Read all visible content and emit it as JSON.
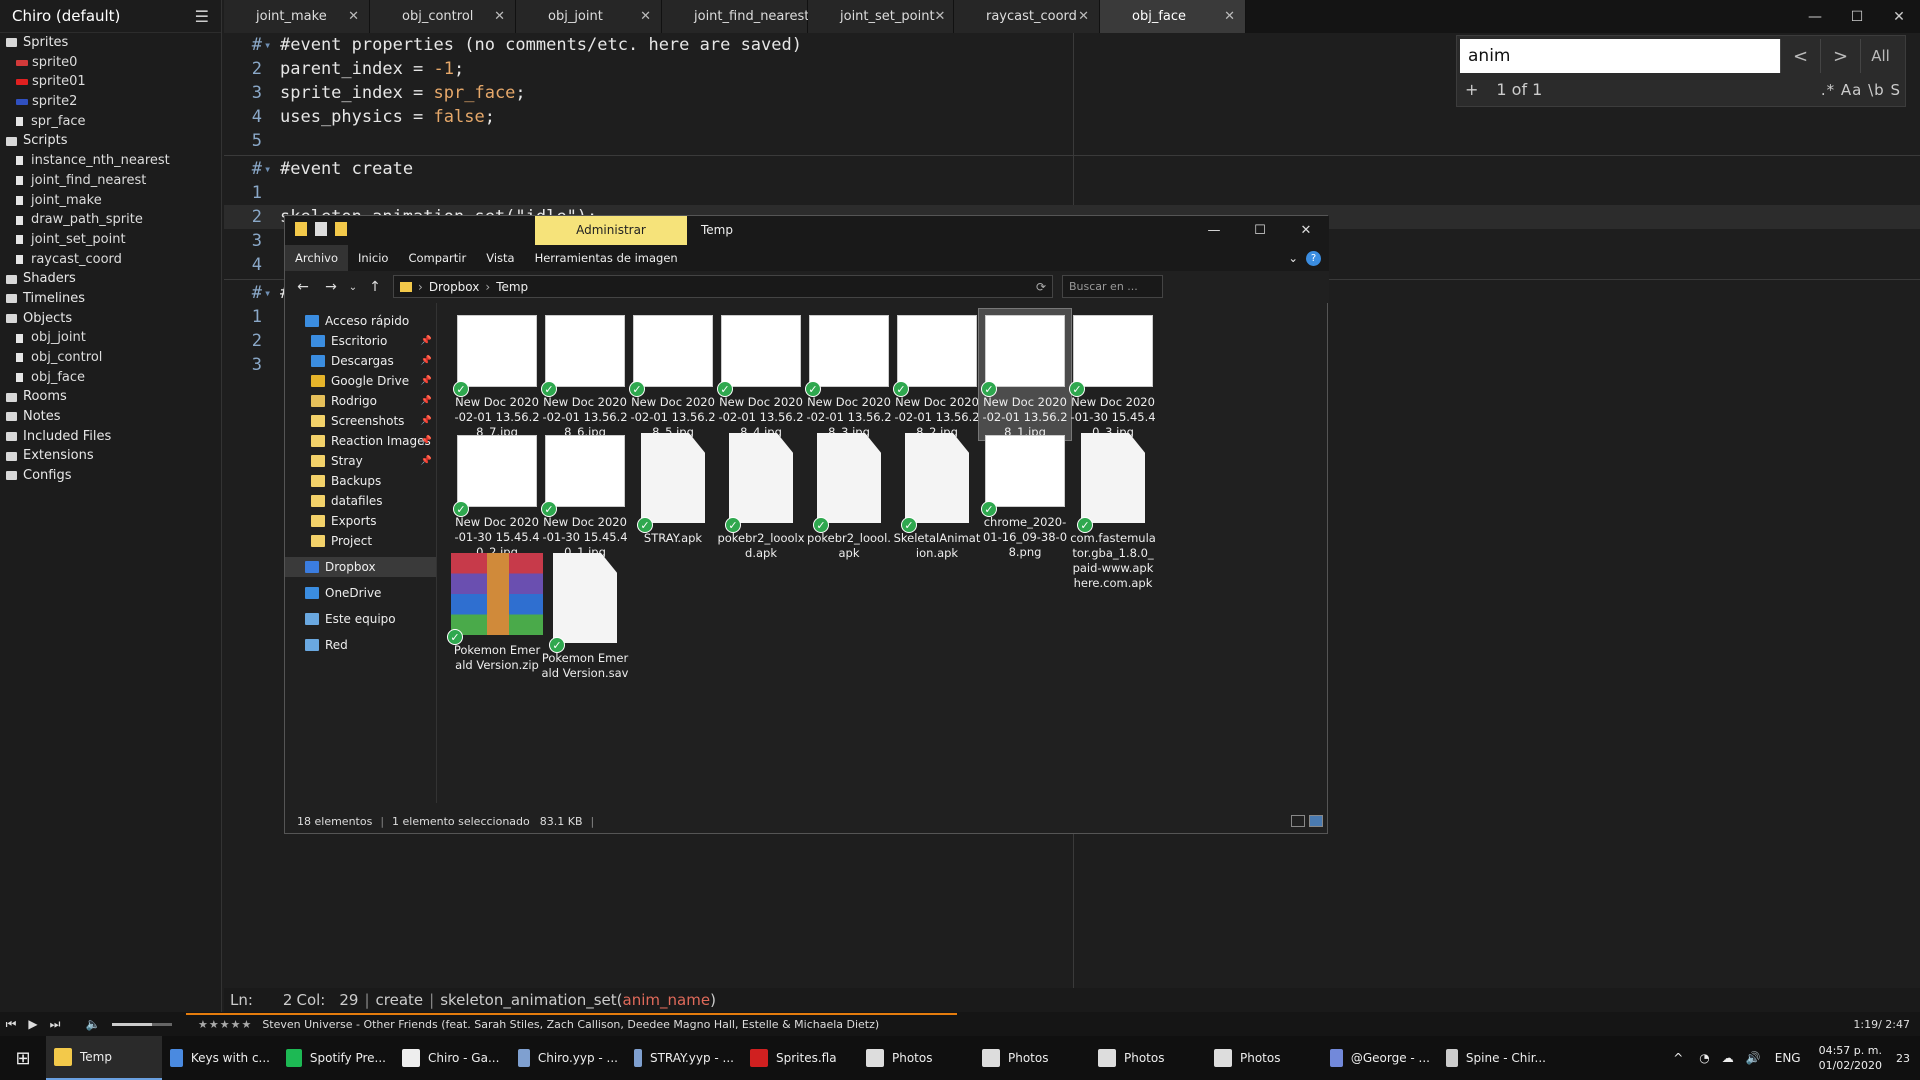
{
  "ide": {
    "project_title": "Chiro (default)",
    "tree": [
      {
        "type": "folder",
        "label": "Sprites"
      },
      {
        "type": "sprite",
        "label": "sprite0",
        "color": "#d23a3a"
      },
      {
        "type": "sprite",
        "label": "sprite01",
        "color": "#e02020"
      },
      {
        "type": "sprite",
        "label": "sprite2",
        "color": "#3050c0"
      },
      {
        "type": "item",
        "label": "spr_face"
      },
      {
        "type": "folder",
        "label": "Scripts"
      },
      {
        "type": "item",
        "label": "instance_nth_nearest"
      },
      {
        "type": "item",
        "label": "joint_find_nearest"
      },
      {
        "type": "item",
        "label": "joint_make"
      },
      {
        "type": "item",
        "label": "draw_path_sprite"
      },
      {
        "type": "item",
        "label": "joint_set_point"
      },
      {
        "type": "item",
        "label": "raycast_coord"
      },
      {
        "type": "folder",
        "label": "Shaders"
      },
      {
        "type": "folder",
        "label": "Timelines"
      },
      {
        "type": "folder",
        "label": "Objects"
      },
      {
        "type": "item",
        "label": "obj_joint"
      },
      {
        "type": "item",
        "label": "obj_control"
      },
      {
        "type": "item",
        "label": "obj_face"
      },
      {
        "type": "folder",
        "label": "Rooms"
      },
      {
        "type": "folder",
        "label": "Notes"
      },
      {
        "type": "folder",
        "label": "Included Files"
      },
      {
        "type": "folder",
        "label": "Extensions"
      },
      {
        "type": "folder",
        "label": "Configs"
      }
    ],
    "tabs": [
      "joint_make",
      "obj_control",
      "obj_joint",
      "joint_find_nearest",
      "joint_set_point",
      "raycast_coord",
      "obj_face"
    ],
    "active_tab": "obj_face",
    "code": {
      "l1_num": "#",
      "l1_comment": "#event properties (no comments/etc. here are saved)",
      "l2_num": "2",
      "l2_a": "parent_index = ",
      "l2_b": "-1",
      ";": ";",
      "l3_num": "3",
      "l3_a": "sprite_index = ",
      "l3_b": "spr_face",
      "l4_num": "4",
      "l4_a": "uses_physics = ",
      "l4_b": "false",
      "l5_num": "5",
      "l6_num": "#",
      "l6_comment": "#event create",
      "l7_num": "1",
      "l8_num": "2",
      "l8_text": "skeleton_animation_set(\"idle\");",
      "l9_num": "3",
      "l10_num": "4",
      "l11_num": "#",
      "l11_text": "#",
      "l12_num": "1",
      "l13_num": "2",
      "l14_num": "3"
    },
    "find": {
      "query": "anim",
      "prev": "<",
      "next": ">",
      "all": "All",
      "plus": "+",
      "count": "1 of 1",
      "options": ".* Aa \\b S"
    },
    "status": {
      "ln": "Ln:",
      "ln_val": "2",
      "col": "Col:",
      "col_val": "29",
      "event": "create",
      "fn": "skeleton_animation_set(",
      "arg": "anim_name",
      ")": ")"
    }
  },
  "explorer": {
    "title": "Temp",
    "context_tab": "Administrar",
    "ribbon": [
      "Archivo",
      "Inicio",
      "Compartir",
      "Vista",
      "Herramientas de imagen"
    ],
    "path": [
      "Dropbox",
      "Temp"
    ],
    "search_placeholder": "Buscar en ...",
    "nav": [
      {
        "label": "Acceso rápido",
        "pin": false,
        "color": "#3b8de0"
      },
      {
        "label": "Escritorio",
        "pin": true,
        "color": "#3b8de0"
      },
      {
        "label": "Descargas",
        "pin": true,
        "color": "#3b8de0"
      },
      {
        "label": "Google Drive",
        "pin": true,
        "color": "#e6b42a"
      },
      {
        "label": "Rodrigo",
        "pin": true,
        "color": "#e6c05a"
      },
      {
        "label": "Screenshots",
        "pin": true,
        "color": "#f3d26a"
      },
      {
        "label": "Reaction Images",
        "pin": true,
        "color": "#f3d26a"
      },
      {
        "label": "Stray",
        "pin": true,
        "color": "#f3d26a"
      },
      {
        "label": "Backups",
        "pin": false,
        "color": "#f3d26a"
      },
      {
        "label": "datafiles",
        "pin": false,
        "color": "#f3d26a"
      },
      {
        "label": "Exports",
        "pin": false,
        "color": "#f3d26a"
      },
      {
        "label": "Project",
        "pin": false,
        "color": "#f3d26a"
      },
      {
        "label": "Dropbox",
        "pin": false,
        "color": "#3b7de0"
      },
      {
        "label": "OneDrive",
        "pin": false,
        "color": "#3b8de0"
      },
      {
        "label": "Este equipo",
        "pin": false,
        "color": "#6aa8e0"
      },
      {
        "label": "Red",
        "pin": false,
        "color": "#6aa8e0"
      }
    ],
    "files": [
      {
        "name": "New Doc 2020-02-01 13.56.28_7.jpg",
        "kind": "img"
      },
      {
        "name": "New Doc 2020-02-01 13.56.28_6.jpg",
        "kind": "img"
      },
      {
        "name": "New Doc 2020-02-01 13.56.28_5.jpg",
        "kind": "img"
      },
      {
        "name": "New Doc 2020-02-01 13.56.28_4.jpg",
        "kind": "img"
      },
      {
        "name": "New Doc 2020-02-01 13.56.28_3.jpg",
        "kind": "img"
      },
      {
        "name": "New Doc 2020-02-01 13.56.28_2.jpg",
        "kind": "img"
      },
      {
        "name": "New Doc 2020-02-01 13.56.28_1.jpg",
        "kind": "img",
        "selected": true
      },
      {
        "name": "New Doc 2020-01-30 15.45.40_3.jpg",
        "kind": "img"
      },
      {
        "name": "New Doc 2020-01-30 15.45.40_2.jpg",
        "kind": "img"
      },
      {
        "name": "New Doc 2020-01-30 15.45.40_1.jpg",
        "kind": "img"
      },
      {
        "name": "STRAY.apk",
        "kind": "doc"
      },
      {
        "name": "pokebr2_looolxd.apk",
        "kind": "doc"
      },
      {
        "name": "pokebr2_loool.apk",
        "kind": "doc"
      },
      {
        "name": "SkeletalAnimation.apk",
        "kind": "doc"
      },
      {
        "name": "chrome_2020-01-16_09-38-08.png",
        "kind": "img"
      },
      {
        "name": "com.fastemulator.gba_1.8.0_paid-www.apkhere.com.apk",
        "kind": "doc"
      },
      {
        "name": "Pokemon Emerald Version.zip",
        "kind": "rar"
      },
      {
        "name": "Pokemon Emerald Version.sav",
        "kind": "doc"
      }
    ],
    "status": {
      "count": "18 elementos",
      "selected": "1 elemento seleccionado",
      "size": "83.1 KB"
    }
  },
  "media": {
    "stars": "★★★★★",
    "track": "Steven Universe - Other Friends (feat. Sarah Stiles, Zach Callison, Deedee Magno Hall, Estelle & Michaela Dietz)",
    "time": "1:19/ 2:47",
    "progress": 0.47
  },
  "taskbar": {
    "items": [
      {
        "label": "Temp",
        "color": "#f3c94a",
        "active": true
      },
      {
        "label": "Keys with c...",
        "color": "#4a8ae0"
      },
      {
        "label": "Spotify Pre...",
        "color": "#1db954"
      },
      {
        "label": "Chiro - Ga...",
        "color": "#eeeeee"
      },
      {
        "label": "Chiro.yyp - ...",
        "color": "#7fa0d0"
      },
      {
        "label": "STRAY.yyp - ...",
        "color": "#7fa0d0"
      },
      {
        "label": "Sprites.fla",
        "color": "#d02020"
      },
      {
        "label": "Photos",
        "color": "#dddddd"
      },
      {
        "label": "Photos",
        "color": "#dddddd"
      },
      {
        "label": "Photos",
        "color": "#dddddd"
      },
      {
        "label": "Photos",
        "color": "#dddddd"
      },
      {
        "label": "@George - ...",
        "color": "#7289da"
      },
      {
        "label": "Spine - Chir...",
        "color": "#cccccc"
      }
    ],
    "lang": "ENG",
    "time": "04:57 p. m.",
    "date": "01/02/2020",
    "notif": "23"
  }
}
